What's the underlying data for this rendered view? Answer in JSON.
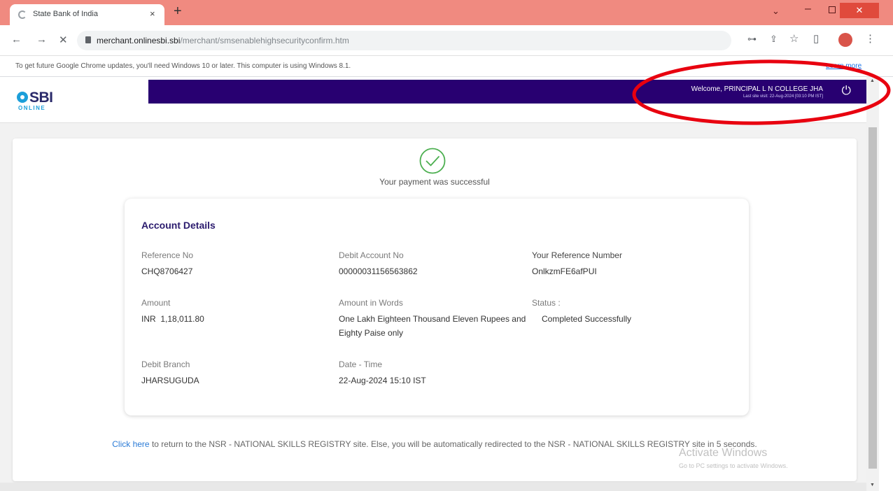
{
  "browser": {
    "tab_title": "State Bank of India",
    "tab_close": "×",
    "new_tab": "+",
    "url_host": "merchant.onlinesbi.sbi",
    "url_path": "/merchant/smsenablehighsecurityconfirm.htm",
    "back": "←",
    "forward": "→",
    "stop": "✕",
    "window_min": "⌄",
    "window_dash": "–",
    "window_close": "✕",
    "key_icon": "⊶",
    "share_icon": "⇪",
    "star_icon": "☆",
    "sidepanel_icon": "▯",
    "menu_icon": "⋮"
  },
  "infobar": {
    "message": "To get future Google Chrome updates, you'll need Windows 10 or later. This computer is using Windows 8.1.",
    "learn_more": "Learn more"
  },
  "header": {
    "logo_text": "SBI",
    "logo_sub": "ONLINE",
    "welcome": "Welcome, PRINCIPAL L N COLLEGE JHA",
    "last_visit": "Last site visit: 22-Aug-2024 [03:10 PM IST]",
    "power_icon": "⏻"
  },
  "payment": {
    "success_message": "Your payment was successful",
    "details_title": "Account Details",
    "fields": {
      "reference_no_label": "Reference No",
      "reference_no": "CHQ8706427",
      "debit_account_label": "Debit Account No",
      "debit_account": "00000031156563862",
      "your_ref_label": "Your Reference Number",
      "your_ref": "OnlkzmFE6afPUI",
      "amount_label": "Amount",
      "amount": "INR  1,18,011.80",
      "amount_words_label": "Amount in Words",
      "amount_words": "One Lakh Eighteen Thousand Eleven Rupees and Eighty Paise only",
      "status_label": "Status :",
      "status": "Completed Successfully",
      "debit_branch_label": "Debit Branch",
      "debit_branch": "JHARSUGUDA",
      "datetime_label": "Date - Time",
      "datetime": "22-Aug-2024 15:10 IST"
    }
  },
  "redirect": {
    "link_text": "Click here",
    "message": " to return to the NSR - NATIONAL SKILLS REGISTRY site. Else, you will be automatically redirected to the NSR - NATIONAL SKILLS REGISTRY site in 5 seconds."
  },
  "watermark": {
    "line1": "Activate Windows",
    "line2": "Go to PC settings to activate Windows."
  },
  "colors": {
    "sbi_purple": "#280071",
    "tab_strip": "#f08a80",
    "success_green": "#4caf50",
    "annotation_red": "#e8000f"
  }
}
